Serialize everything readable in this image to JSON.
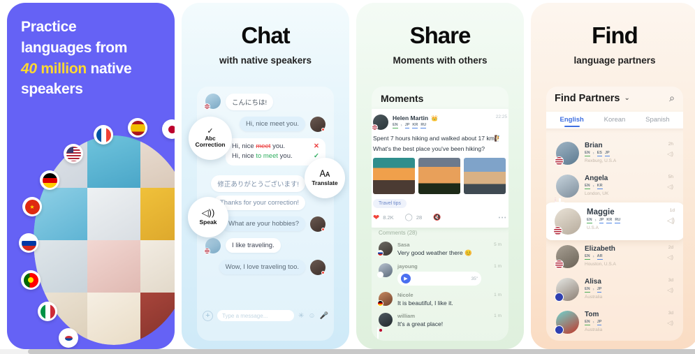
{
  "panels": {
    "hero": {
      "line1": "Practice",
      "line2": "languages from",
      "highlight_number": "40",
      "highlight_word": "million",
      "line3_rest": "native",
      "line4": "speakers",
      "highlight_color": "#ffd930",
      "background_color": "#6562f5",
      "flags": [
        {
          "name": "flag-france",
          "label": "France"
        },
        {
          "name": "flag-spain",
          "label": "Spain"
        },
        {
          "name": "flag-japan",
          "label": "Japan"
        },
        {
          "name": "flag-usa",
          "label": "USA"
        },
        {
          "name": "flag-germany",
          "label": "Germany"
        },
        {
          "name": "flag-china",
          "label": "China"
        },
        {
          "name": "flag-russia",
          "label": "Russia"
        },
        {
          "name": "flag-portugal",
          "label": "Portugal"
        },
        {
          "name": "flag-italy",
          "label": "Italy"
        },
        {
          "name": "flag-south-korea",
          "label": "South Korea"
        }
      ]
    },
    "chat": {
      "title": "Chat",
      "subtitle": "with native speakers",
      "features": [
        {
          "icon": "check-abc-icon",
          "top_label": "Abc",
          "label": "Correction"
        },
        {
          "icon": "translate-icon",
          "label": "Translate"
        },
        {
          "icon": "speaker-icon",
          "label": "Speak"
        }
      ],
      "messages": [
        {
          "side": "in",
          "text": "こんにちは!"
        },
        {
          "side": "out",
          "text": "Hi, nice meet you."
        },
        {
          "side": "correction",
          "wrong_prefix": "Hi, nice ",
          "wrong_word": "meet",
          "wrong_suffix": " you.",
          "right_prefix": "Hi, nice ",
          "right_word": "to meet",
          "right_suffix": " you.",
          "x_mark": "✕",
          "check_mark": "✓"
        },
        {
          "side": "in2",
          "text": "修正ありがとうございます!"
        },
        {
          "side": "in2",
          "text": "Thanks for your correction!"
        },
        {
          "side": "out",
          "text": "What are your hobbies?"
        },
        {
          "side": "in",
          "text": "I like traveling."
        },
        {
          "side": "out",
          "text": "Wow, I love traveling too."
        }
      ],
      "input": {
        "placeholder": "Type a message...",
        "plus_icon": "plus-icon",
        "sticker_icon": "sticker-icon",
        "emoji_icon": "emoji-icon",
        "mic_icon": "microphone-icon"
      }
    },
    "share": {
      "title": "Share",
      "subtitle": "Moments with others",
      "feed_title": "Moments",
      "post": {
        "author": "Helen Martin",
        "badge_icon": "crown-icon",
        "time": "22:25",
        "languages": [
          "EN",
          "JP",
          "KR",
          "RU"
        ],
        "arrow": "›",
        "text_line1": "Spent 7 hours hiking and walked about 17 km🧗",
        "text_line2": "What's the best place you've been hiking?",
        "tag": "Travel tips",
        "likes": "8.2K",
        "comments": "28",
        "mute_icon": "no-sound-icon",
        "more_icon": "more-dots-icon"
      },
      "comments_header": "Comments  (28)",
      "comments": [
        {
          "name": "Sasa",
          "text": "Very good weather there 😊",
          "time": "5 m",
          "type": "text",
          "flag": "flag-russia"
        },
        {
          "name": "jayoung",
          "time": "1 m",
          "type": "voice",
          "duration": "35\"",
          "play_icon": "play-icon",
          "flag": "flag-south-korea"
        },
        {
          "name": "Nicole",
          "text": "It is beautiful, I like it.",
          "time": "1 m",
          "type": "text",
          "flag": "flag-germany"
        },
        {
          "name": "william",
          "text": "It's a great place!",
          "time": "1 m",
          "type": "text",
          "flag": "flag-japan"
        }
      ]
    },
    "find": {
      "title": "Find",
      "subtitle": "language partners",
      "header_title": "Find Partners",
      "chevron_icon": "chevron-down-icon",
      "search_icon": "search-icon",
      "tabs": [
        {
          "label": "English",
          "active": true
        },
        {
          "label": "Korean",
          "active": false
        },
        {
          "label": "Spanish",
          "active": false
        }
      ],
      "partners": [
        {
          "name": "Brian",
          "languages": [
            "EN",
            "ES",
            "JP"
          ],
          "location": "Rexburg, U.S.A",
          "time": "2h",
          "flag": "flag-usa",
          "selected": false
        },
        {
          "name": "Angela",
          "languages": [
            "EN",
            "KR"
          ],
          "location": "London, UK",
          "time": "5h",
          "flag": "flag-uk",
          "selected": false
        },
        {
          "name": "Maggie",
          "languages": [
            "EN",
            "JP",
            "KR",
            "RU"
          ],
          "location": "U.S.A",
          "time": "1d",
          "flag": "flag-usa",
          "selected": true
        },
        {
          "name": "Elizabeth",
          "languages": [
            "EN",
            "AR"
          ],
          "location": "Houston, U.S.A",
          "time": "2d",
          "flag": "flag-usa",
          "selected": false
        },
        {
          "name": "Alisa",
          "languages": [
            "EN",
            "JP"
          ],
          "location": "Australia",
          "time": "3d",
          "flag": "flag-australia",
          "selected": false
        },
        {
          "name": "Tom",
          "languages": [
            "EN",
            "JP"
          ],
          "location": "Australia",
          "time": "3d",
          "flag": "flag-australia",
          "selected": false
        }
      ],
      "speaker_icon": "speaker-small-icon",
      "arrow": "›"
    }
  }
}
